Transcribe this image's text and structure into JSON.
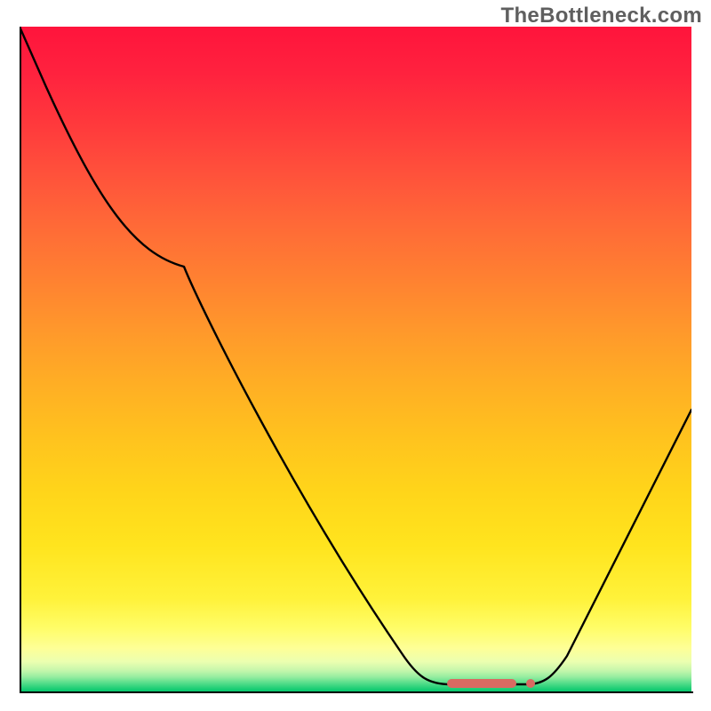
{
  "attribution": "TheBottleneck.com",
  "chart_data": {
    "type": "line",
    "title": "",
    "xlabel": "",
    "ylabel": "",
    "xlim": [
      0,
      100
    ],
    "ylim": [
      0,
      100
    ],
    "x": [
      0,
      4,
      12,
      18,
      24,
      30,
      38,
      46,
      54,
      60,
      64,
      68,
      73,
      76,
      78,
      82,
      88,
      94,
      100
    ],
    "values": [
      100,
      91,
      73,
      66,
      64,
      57,
      46,
      33,
      18,
      6,
      2,
      1,
      1,
      1,
      2,
      6,
      20,
      33,
      42
    ],
    "gradient_background": {
      "top_color": "#ff143c",
      "bottom_color": "#04c86d",
      "meaning": "red = high bottleneck, green = low bottleneck"
    },
    "optimal_marker": {
      "x_range": [
        64,
        76
      ],
      "color": "#d96a62"
    },
    "note": "No axis tick labels, legend, or numeric labels are visible in the source image; x and y values are estimated from curve geometry on a 0–100 scale."
  }
}
